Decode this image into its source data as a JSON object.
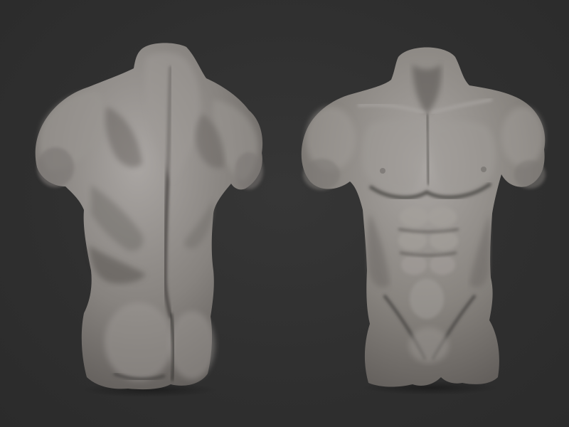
{
  "scene": {
    "background_color": "#303030",
    "material_color": "#8a8683",
    "material_highlight": "#b3afac",
    "material_shadow": "#4e4b49",
    "models": [
      {
        "id": "torso-back",
        "view": "back",
        "icon": "torso-back-sculpt"
      },
      {
        "id": "torso-front",
        "view": "front",
        "icon": "torso-front-sculpt"
      }
    ]
  }
}
